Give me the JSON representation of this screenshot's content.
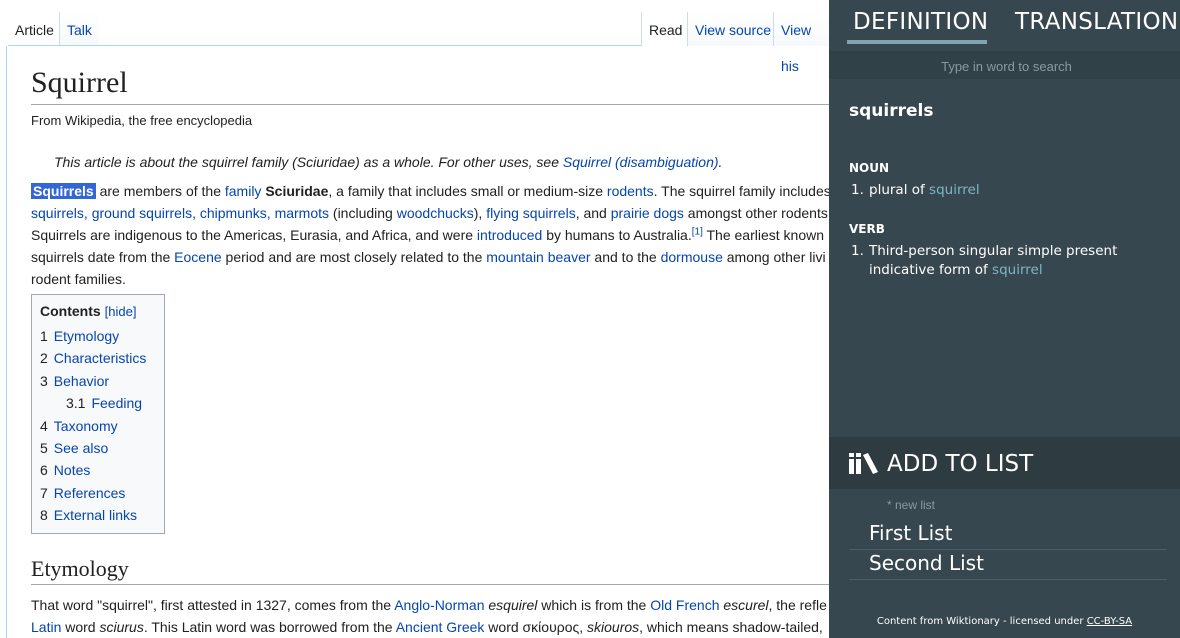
{
  "wiki": {
    "tabs": {
      "article": "Article",
      "talk": "Talk",
      "read": "Read",
      "view_source": "View source",
      "view_history": "View his"
    },
    "title": "Squirrel",
    "tagline": "From Wikipedia, the free encyclopedia",
    "hatnote": {
      "text": "This article is about the squirrel family (Sciuridae) as a whole. For other uses, see ",
      "link": "Squirrel (disambiguation)",
      "end": "."
    },
    "intro": {
      "l1": {
        "hl": "Squirrels",
        "t1": " are members of the ",
        "a1": "family",
        "b1": "Sciuridae",
        "t2": ", a family that includes small or medium-size ",
        "a2": "rodents",
        "t3": ". The squirrel family includes"
      },
      "l2": {
        "a1": "squirrels",
        "t1": ", ",
        "a2": "ground squirrels",
        "t2": ", ",
        "a3": "chipmunks",
        "t3": ", ",
        "a4": "marmots",
        "t4": " (including ",
        "a5": "woodchucks",
        "t5": "), ",
        "a6": "flying squirrels",
        "t6": ", and ",
        "a7": "prairie dogs",
        "t7": " amongst other rodents"
      },
      "l3": {
        "t1": "Squirrels are indigenous to the Americas, Eurasia, and Africa, and were ",
        "a1": "introduced",
        "t2": " by humans to Australia.",
        "sup": "[1]",
        "t3": " The earliest known"
      },
      "l4": {
        "t1": "squirrels date from the ",
        "a1": "Eocene",
        "t2": " period and are most closely related to the ",
        "a2": "mountain beaver",
        "t3": " and to the ",
        "a3": "dormouse",
        "t4": " among other livi"
      },
      "l5": {
        "t1": "rodent families."
      }
    },
    "toc": {
      "title": "Contents",
      "hide": "[hide]",
      "items": [
        {
          "num": "1",
          "label": "Etymology"
        },
        {
          "num": "2",
          "label": "Characteristics"
        },
        {
          "num": "3",
          "label": "Behavior"
        },
        {
          "num": "3.1",
          "label": "Feeding"
        },
        {
          "num": "4",
          "label": "Taxonomy"
        },
        {
          "num": "5",
          "label": "See also"
        },
        {
          "num": "6",
          "label": "Notes"
        },
        {
          "num": "7",
          "label": "References"
        },
        {
          "num": "8",
          "label": "External links"
        }
      ]
    },
    "etymology": {
      "heading": "Etymology",
      "l1": {
        "t1": "That word \"squirrel\", first attested in 1327, comes from the ",
        "a1": "Anglo-Norman",
        "t2": " ",
        "i1": "esquirel",
        "t3": " which is from the ",
        "a2": "Old French",
        "t4": " ",
        "i2": "escurel",
        "t5": ", the refle"
      },
      "l2": {
        "a1": "Latin",
        "t1": " word ",
        "i1": "sciurus",
        "t2": ". This Latin word was borrowed from the ",
        "a2": "Ancient Greek",
        "t3": " word σκίουρος, ",
        "i2": "skiouros",
        "t4": ", which means shadow-tailed,"
      }
    }
  },
  "dict": {
    "tabs": {
      "definition": "DEFINITION",
      "translation": "TRANSLATION"
    },
    "search_placeholder": "Type in word to search",
    "word": "squirrels",
    "noun": {
      "label": "NOUN",
      "num": "1.",
      "text": "plural of ",
      "link": "squirrel"
    },
    "verb": {
      "label": "VERB",
      "num": "1.",
      "text1": "Third-person singular simple present",
      "text2": "indicative form of ",
      "link": "squirrel"
    },
    "add_to_list": "ADD TO LIST",
    "new_list": "* new list",
    "lists": [
      "First List",
      "Second List"
    ],
    "footer": {
      "text": "Content from Wiktionary - licensed under ",
      "link": "CC-BY-SA"
    },
    "colors": {
      "panel": "#37474f",
      "link": "#7fb6c2",
      "accent": "#80a4b0"
    }
  }
}
